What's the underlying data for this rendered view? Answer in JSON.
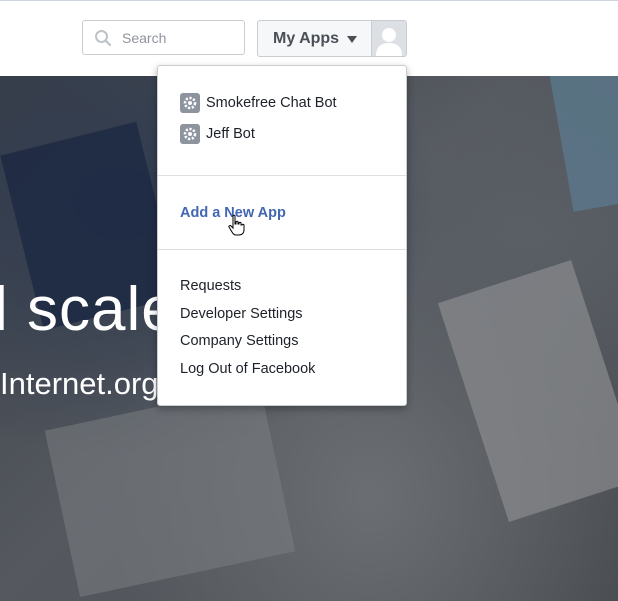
{
  "header": {
    "search": {
      "placeholder": "Search",
      "value": ""
    },
    "my_apps": {
      "label": "My Apps"
    }
  },
  "hero": {
    "headline": "l scale",
    "subline": "Internet.org"
  },
  "menu": {
    "apps": [
      {
        "label": "Smokefree Chat Bot",
        "icon": "gear-icon"
      },
      {
        "label": "Jeff Bot",
        "icon": "gear-icon"
      }
    ],
    "add_app_label": "Add a New App",
    "links": [
      {
        "label": "Requests"
      },
      {
        "label": "Developer Settings"
      },
      {
        "label": "Company Settings"
      },
      {
        "label": "Log Out of Facebook"
      }
    ]
  },
  "colors": {
    "link_blue": "#4267b2",
    "text_dark": "#1d2129",
    "border": "#c9ccd1"
  }
}
